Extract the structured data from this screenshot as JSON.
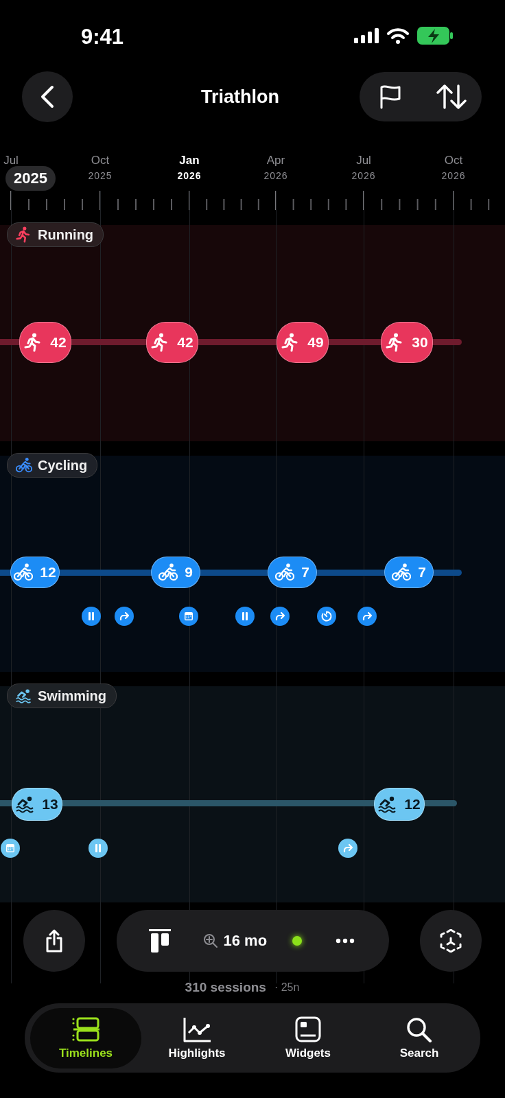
{
  "status_bar": {
    "time": "9:41"
  },
  "header": {
    "title": "Triathlon"
  },
  "axis": {
    "year_badge": "2025",
    "ticks": [
      {
        "month": "Jul",
        "selected": false
      },
      {
        "month": "Oct",
        "year": "2025",
        "selected": false
      },
      {
        "month": "Jan",
        "year": "2026",
        "selected": true
      },
      {
        "month": "Apr",
        "year": "2026",
        "selected": false
      },
      {
        "month": "Jul",
        "year": "2026",
        "selected": false
      },
      {
        "month": "Oct",
        "year": "2026",
        "selected": false
      }
    ]
  },
  "lanes": [
    {
      "kind": "running",
      "label": "Running",
      "color": "#e8365c",
      "sessions": [
        {
          "count": "42"
        },
        {
          "count": "42"
        },
        {
          "count": "49"
        },
        {
          "count": "30"
        }
      ]
    },
    {
      "kind": "cycling",
      "label": "Cycling",
      "color": "#1c8cf5",
      "sessions": [
        {
          "count": "12"
        },
        {
          "count": "9"
        },
        {
          "count": "7"
        },
        {
          "count": "7"
        }
      ],
      "markers": [
        {
          "kind": "pause"
        },
        {
          "kind": "redo"
        },
        {
          "kind": "calendar"
        },
        {
          "kind": "pause"
        },
        {
          "kind": "redo"
        },
        {
          "kind": "timer"
        },
        {
          "kind": "redo"
        }
      ]
    },
    {
      "kind": "swimming",
      "label": "Swimming",
      "color": "#6cc6f2",
      "sessions": [
        {
          "count": "13"
        },
        {
          "count": "12"
        }
      ],
      "markers": [
        {
          "kind": "calendar"
        },
        {
          "kind": "pause"
        },
        {
          "kind": "redo"
        }
      ]
    }
  ],
  "toolbar": {
    "zoom": "16 mo",
    "live": true
  },
  "summary": {
    "sessions": "310 sessions",
    "note": "· 25n"
  },
  "tabs": [
    {
      "label": "Timelines",
      "selected": true
    },
    {
      "label": "Highlights",
      "selected": false
    },
    {
      "label": "Widgets",
      "selected": false
    },
    {
      "label": "Search",
      "selected": false
    }
  ]
}
